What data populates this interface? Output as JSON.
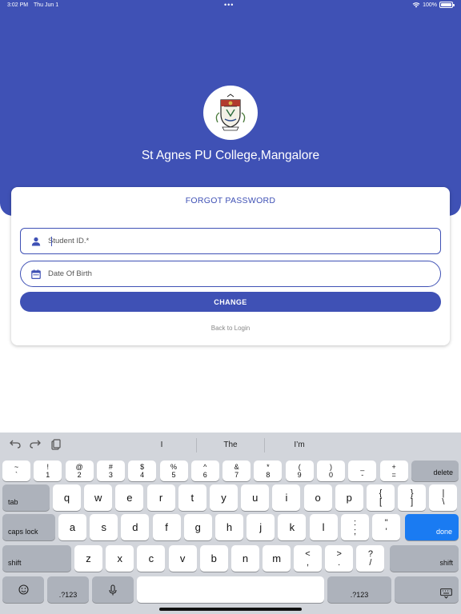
{
  "status_bar": {
    "time": "3:02 PM",
    "date": "Thu Jun 1",
    "dots": "•••",
    "battery_text": "100%",
    "battery_level": 1.0,
    "wifi_icon": "wifi-icon"
  },
  "header": {
    "college_name": "St Agnes PU College,Mangalore",
    "logo_icon": "college-crest-icon",
    "background_color": "#3f51b5"
  },
  "form": {
    "title": "FORGOT PASSWORD",
    "student_id": {
      "placeholder": "Student ID.*",
      "value": "",
      "icon": "person-icon"
    },
    "dob": {
      "placeholder": "Date Of Birth",
      "value": "",
      "icon": "calendar-icon"
    },
    "change_label": "CHANGE",
    "back_label": "Back to Login",
    "accent_color": "#3f51b5"
  },
  "keyboard": {
    "toolbar_icons": [
      "undo-icon",
      "redo-icon",
      "paste-icon"
    ],
    "suggestions": [
      "I",
      "The",
      "I’m"
    ],
    "row_numbers": [
      {
        "top": "~",
        "bottom": "`"
      },
      {
        "top": "!",
        "bottom": "1"
      },
      {
        "top": "@",
        "bottom": "2"
      },
      {
        "top": "#",
        "bottom": "3"
      },
      {
        "top": "$",
        "bottom": "4"
      },
      {
        "top": "%",
        "bottom": "5"
      },
      {
        "top": "^",
        "bottom": "6"
      },
      {
        "top": "&",
        "bottom": "7"
      },
      {
        "top": "*",
        "bottom": "8"
      },
      {
        "top": "(",
        "bottom": "9"
      },
      {
        "top": ")",
        "bottom": "0"
      },
      {
        "top": "_",
        "bottom": "-"
      },
      {
        "top": "+",
        "bottom": "="
      }
    ],
    "delete_label": "delete",
    "tab_label": "tab",
    "row_q": [
      "q",
      "w",
      "e",
      "r",
      "t",
      "y",
      "u",
      "i",
      "o",
      "p"
    ],
    "row_q_extra": [
      {
        "top": "{",
        "bottom": "["
      },
      {
        "top": "}",
        "bottom": "]"
      },
      {
        "top": "|",
        "bottom": "\\"
      }
    ],
    "caps_label": "caps lock",
    "row_a": [
      "a",
      "s",
      "d",
      "f",
      "g",
      "h",
      "j",
      "k",
      "l"
    ],
    "row_a_extra": [
      {
        "top": ":",
        "bottom": ";"
      },
      {
        "top": "\"",
        "bottom": "'"
      }
    ],
    "done_label": "done",
    "shift_label": "shift",
    "row_z": [
      "z",
      "x",
      "c",
      "v",
      "b",
      "n",
      "m"
    ],
    "row_z_extra": [
      {
        "top": "<",
        "bottom": ","
      },
      {
        "top": ">",
        "bottom": "."
      },
      {
        "top": "?",
        "bottom": "/"
      }
    ],
    "numbers_label": ".?123",
    "emoji_icon": "emoji-icon",
    "mic_icon": "microphone-icon",
    "hide_keyboard_icon": "keyboard-hide-icon"
  }
}
